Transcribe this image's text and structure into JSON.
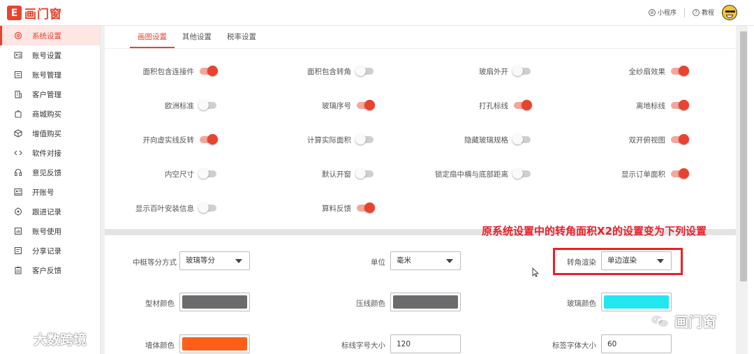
{
  "header": {
    "logo_mark": "E",
    "logo_text": "画门窗",
    "mini_program": "小程序",
    "tutorial": "教程"
  },
  "sidebar": {
    "items": [
      {
        "label": "系统设置",
        "icon": "gear-icon",
        "active": true
      },
      {
        "label": "账号设置",
        "icon": "id-card-icon"
      },
      {
        "label": "账号管理",
        "icon": "list-icon"
      },
      {
        "label": "客户管理",
        "icon": "building-icon"
      },
      {
        "label": "商城购买",
        "icon": "bag-icon"
      },
      {
        "label": "增值购买",
        "icon": "cube-icon"
      },
      {
        "label": "软件对接",
        "icon": "code-icon"
      },
      {
        "label": "意见反馈",
        "icon": "headset-icon"
      },
      {
        "label": "开账号",
        "icon": "id-badge-icon"
      },
      {
        "label": "跟进记录",
        "icon": "target-icon"
      },
      {
        "label": "账号使用",
        "icon": "chart-icon"
      },
      {
        "label": "分享记录",
        "icon": "share-icon"
      },
      {
        "label": "客户反馈",
        "icon": "clipboard-icon"
      }
    ]
  },
  "tabs": [
    {
      "label": "画图设置",
      "active": true
    },
    {
      "label": "其他设置"
    },
    {
      "label": "税率设置"
    }
  ],
  "switch_rows": [
    [
      {
        "label": "面积包含连接件",
        "on": true
      },
      {
        "label": "面积包含转角",
        "on": false
      },
      {
        "label": "玻扇外开",
        "on": false
      },
      {
        "label": "全纱扇效果",
        "on": true
      }
    ],
    [
      {
        "label": "欧洲标准",
        "on": false
      },
      {
        "label": "玻璃序号",
        "on": true
      },
      {
        "label": "打孔标线",
        "on": true
      },
      {
        "label": "离地标线",
        "on": true
      }
    ],
    [
      {
        "label": "开向虚实线反转",
        "on": true
      },
      {
        "label": "计算实际面积",
        "on": false
      },
      {
        "label": "隐藏玻璃规格",
        "on": false
      },
      {
        "label": "双开俯视图",
        "on": true
      }
    ],
    [
      {
        "label": "内空尺寸",
        "on": false
      },
      {
        "label": "默认开窗",
        "on": false
      },
      {
        "label": "锁定扇中横与底部距离",
        "on": false
      },
      {
        "label": "显示订单面积",
        "on": true
      }
    ],
    [
      {
        "label": "显示百叶安装信息",
        "on": false
      },
      {
        "label": "算料反馈",
        "on": true
      }
    ]
  ],
  "form": {
    "mullion_label": "中梃等分方式",
    "mullion_value": "玻璃等分",
    "unit_label": "单位",
    "unit_value": "毫米",
    "corner_label": "转角渲染",
    "corner_value": "单边渲染",
    "profile_color_label": "型材颜色",
    "profile_color": "#6b6b6e",
    "bead_color_label": "压线颜色",
    "bead_color": "#6b6b6e",
    "glass_color_label": "玻璃颜色",
    "glass_color": "#22e6f0",
    "wall_color_label": "墙体颜色",
    "wall_color": "#ff5e1a",
    "dim_font_label": "标线字号大小",
    "dim_font_value": "120",
    "tag_font_label": "标签字体大小",
    "tag_font_value": "60"
  },
  "annotation": {
    "text": "原系统设置中的转角面积X2的设置变为下列设置",
    "color": "#e8202a"
  },
  "watermarks": {
    "left": "大数跨境",
    "right": "画门窗"
  },
  "colors": {
    "accent": "#e8432f"
  }
}
